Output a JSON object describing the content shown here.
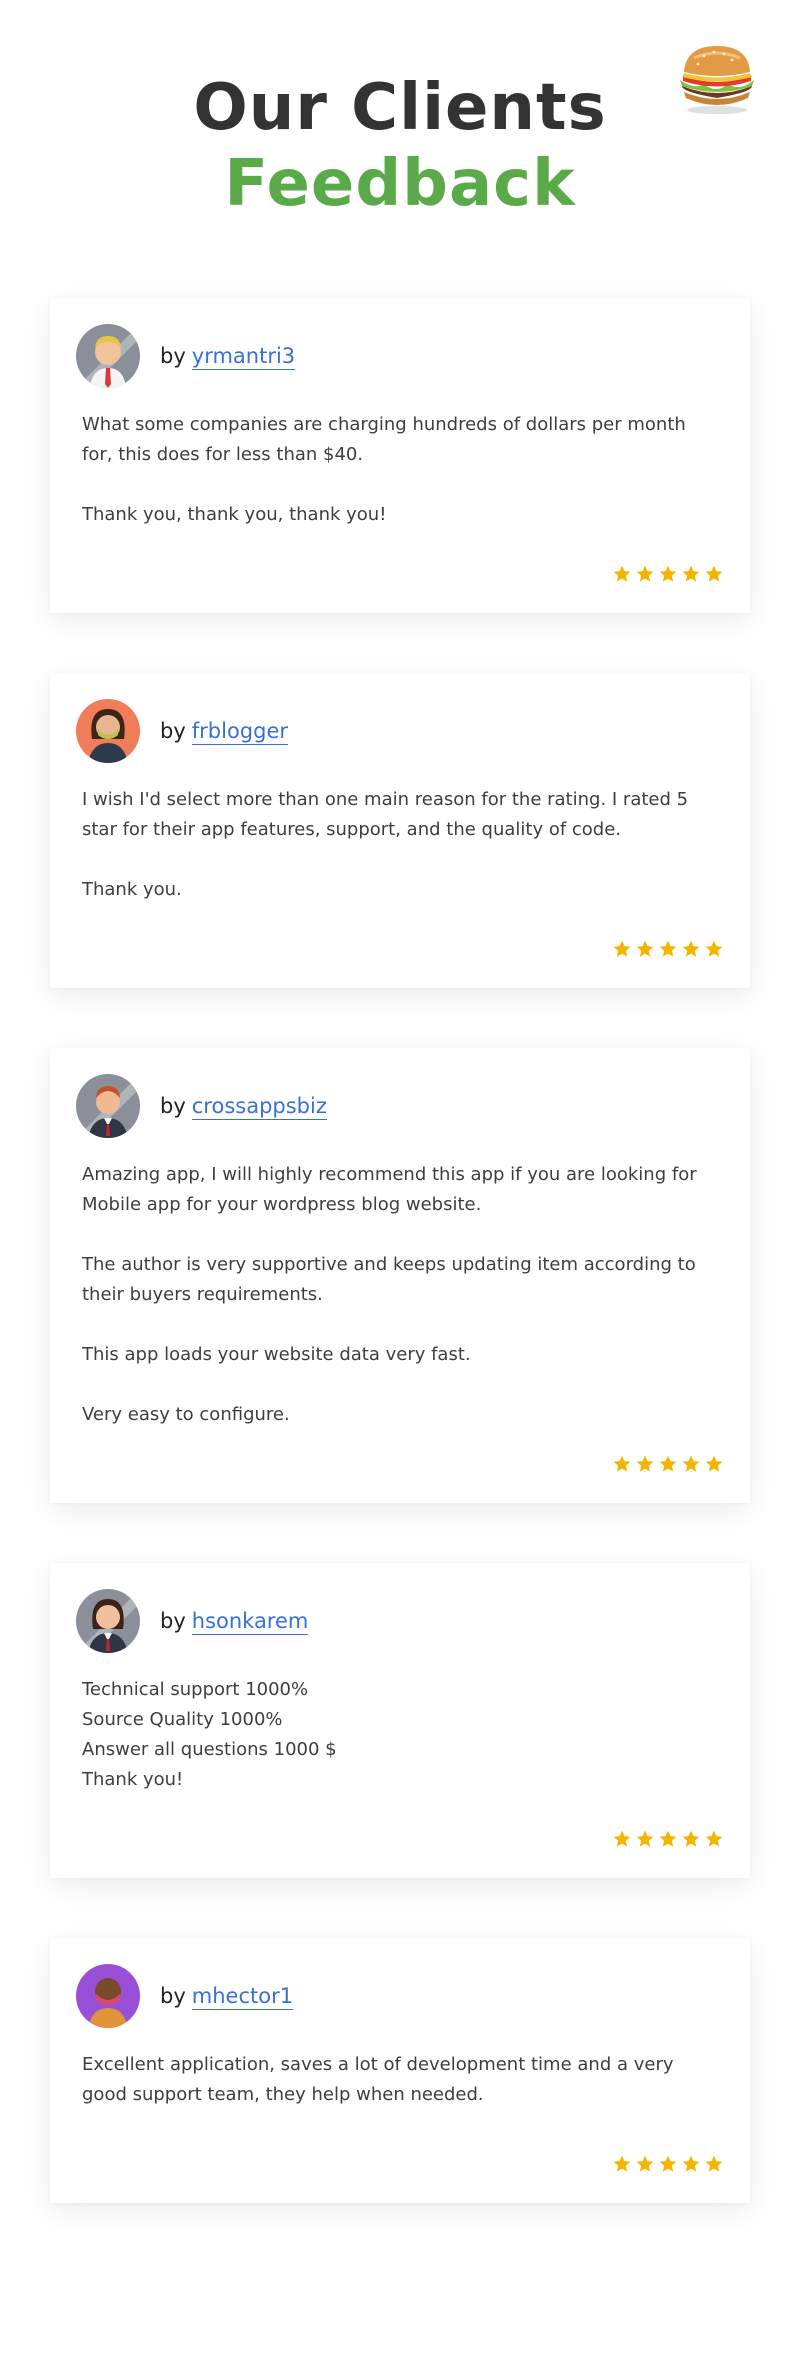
{
  "header": {
    "title_line1": "Our Clients",
    "title_line2": "Feedback"
  },
  "reviews": [
    {
      "by": "by",
      "author": "yrmantri3",
      "paragraphs": [
        "What some companies are charging hundreds of dollars per month for, this does for less than $40.",
        "Thank you, thank you, thank you!"
      ],
      "rating": 5
    },
    {
      "by": "by",
      "author": "frblogger",
      "paragraphs": [
        "I wish I'd select more than one main reason for the rating. I rated 5 star for their app features, support, and the quality of code.",
        "Thank you."
      ],
      "rating": 5
    },
    {
      "by": "by",
      "author": "crossappsbiz",
      "paragraphs": [
        "Amazing app, I will highly recommend this app if you are looking for Mobile app for your wordpress blog website.",
        "The author is very supportive and keeps updating item according to their buyers requirements.",
        "This app loads your website data very fast.",
        "Very easy to configure."
      ],
      "rating": 5
    },
    {
      "by": "by",
      "author": "hsonkarem",
      "lines": [
        "Technical support 1000%",
        "Source Quality 1000%",
        "Answer all questions 1000 $",
        "Thank you!"
      ],
      "rating": 5
    },
    {
      "by": "by",
      "author": "mhector1",
      "paragraphs": [
        "Excellent application, saves a lot of development time and a very good support team, they help when needed."
      ],
      "rating": 5
    }
  ],
  "colors": {
    "title_dark": "#333333",
    "title_green": "#5aaa4a",
    "link": "#3a6fd8",
    "star": "#f5b400"
  },
  "icons": {
    "burger": "burger-icon",
    "star": "star-icon"
  }
}
